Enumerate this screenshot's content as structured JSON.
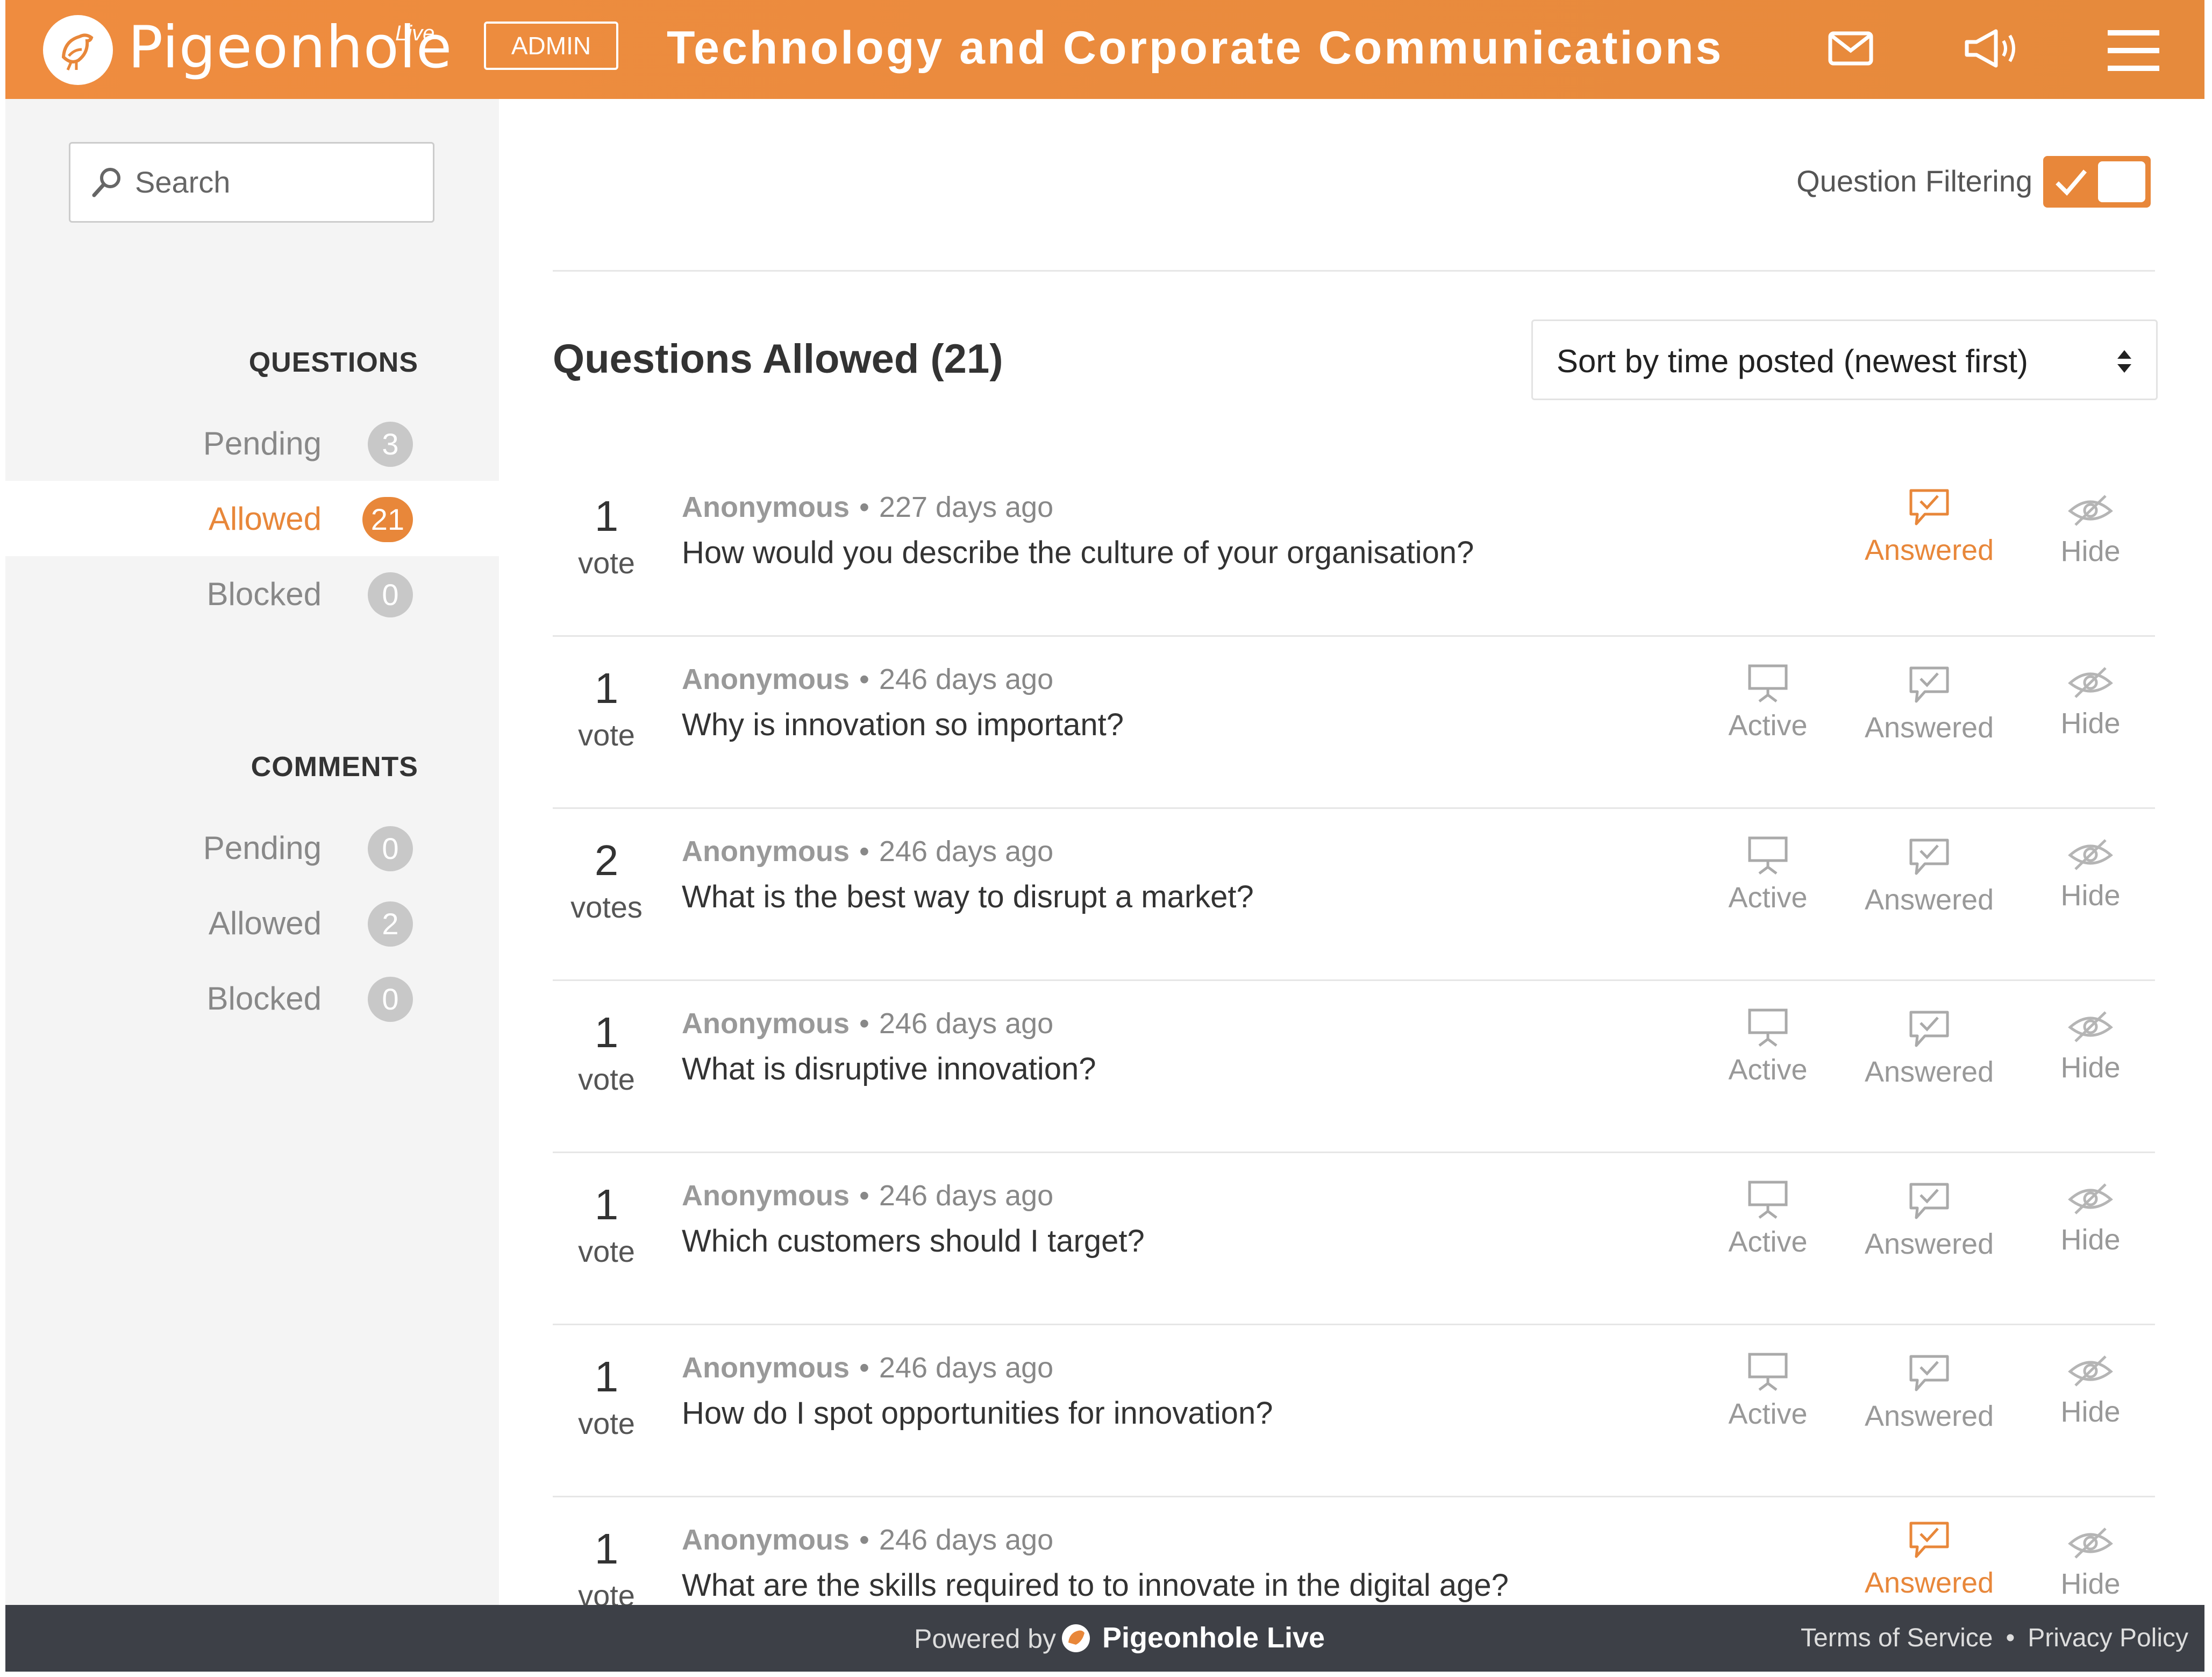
{
  "header": {
    "brand": "Pigeonhole",
    "brand_live": "Live",
    "admin_label": "ADMIN",
    "event_title": "Technology and Corporate Communications",
    "icons": [
      "mail-icon",
      "megaphone-icon",
      "menu-icon"
    ]
  },
  "sidebar": {
    "search_placeholder": "Search",
    "questions_heading": "QUESTIONS",
    "questions": [
      {
        "label": "Pending",
        "count": "3",
        "active": false
      },
      {
        "label": "Allowed",
        "count": "21",
        "active": true
      },
      {
        "label": "Blocked",
        "count": "0",
        "active": false
      }
    ],
    "comments_heading": "COMMENTS",
    "comments": [
      {
        "label": "Pending",
        "count": "0"
      },
      {
        "label": "Allowed",
        "count": "2"
      },
      {
        "label": "Blocked",
        "count": "0"
      }
    ]
  },
  "main": {
    "filter_label": "Question Filtering",
    "filter_on": true,
    "section_title": "Questions Allowed (21)",
    "sort_label": "Sort by time posted (newest first)",
    "questions": [
      {
        "votes": "1",
        "unit": "vote",
        "author": "Anonymous",
        "time": "227 days ago",
        "text": "How would you describe the culture of your organisation?",
        "answered": true
      },
      {
        "votes": "1",
        "unit": "vote",
        "author": "Anonymous",
        "time": "246 days ago",
        "text": "Why is innovation so important?",
        "answered": false
      },
      {
        "votes": "2",
        "unit": "votes",
        "author": "Anonymous",
        "time": "246 days ago",
        "text": "What is the best way to disrupt a market?",
        "answered": false
      },
      {
        "votes": "1",
        "unit": "vote",
        "author": "Anonymous",
        "time": "246 days ago",
        "text": "What is disruptive innovation?",
        "answered": false
      },
      {
        "votes": "1",
        "unit": "vote",
        "author": "Anonymous",
        "time": "246 days ago",
        "text": "Which customers should I target?",
        "answered": false
      },
      {
        "votes": "1",
        "unit": "vote",
        "author": "Anonymous",
        "time": "246 days ago",
        "text": "How do I spot opportunities for innovation?",
        "answered": false
      },
      {
        "votes": "1",
        "unit": "vote",
        "author": "Anonymous",
        "time": "246 days ago",
        "text": "What are the skills required to to innovate in the digital age?",
        "answered": true
      }
    ],
    "actions": {
      "active": "Active",
      "answered": "Answered",
      "hide": "Hide"
    }
  },
  "footer": {
    "powered_by": "Powered by",
    "brand": "Pigeonhole Live",
    "terms": "Terms of Service",
    "privacy": "Privacy Policy"
  },
  "colors": {
    "accent": "#e8873a",
    "footer": "#3d4047",
    "sidebar": "#f4f4f4"
  }
}
